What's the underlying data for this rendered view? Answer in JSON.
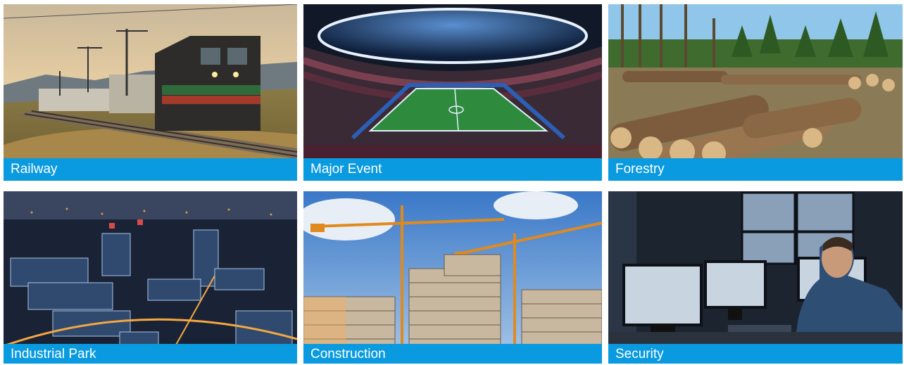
{
  "tiles": [
    {
      "label": "Railway",
      "image": "freight-train-on-railway"
    },
    {
      "label": "Major Event",
      "image": "football-stadium-at-night"
    },
    {
      "label": "Forestry",
      "image": "logs-in-forest-clearing"
    },
    {
      "label": "Industrial Park",
      "image": "aerial-industrial-park-at-night"
    },
    {
      "label": "Construction",
      "image": "cranes-over-building-site"
    },
    {
      "label": "Security",
      "image": "security-operator-at-monitors"
    }
  ],
  "colors": {
    "caption_bar": "#0a9ae0",
    "caption_text": "#ffffff"
  }
}
